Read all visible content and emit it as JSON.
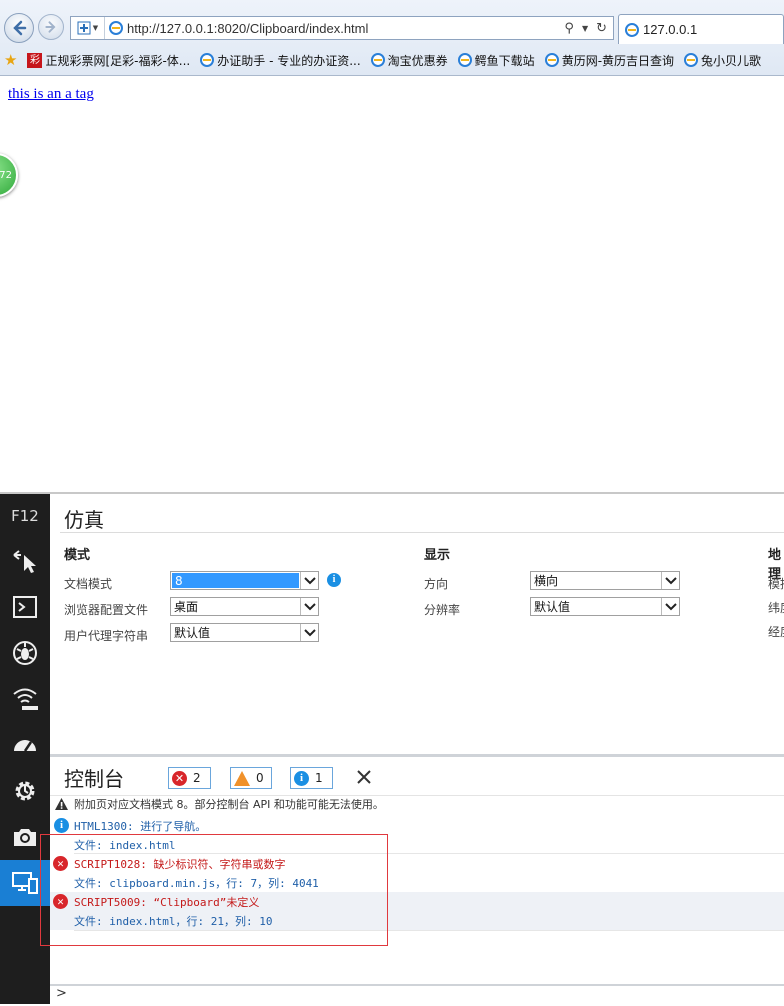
{
  "browser": {
    "url": "http://127.0.0.1:8020/Clipboard/index.html",
    "tab_title": "127.0.0.1",
    "favorites": [
      {
        "label": "正规彩票网[足彩-福彩-体...",
        "icon": "cai-icon",
        "icon_text": "彩"
      },
      {
        "label": "办证助手 - 专业的办证资...",
        "icon": "ie-page-icon"
      },
      {
        "label": "淘宝优惠券",
        "icon": "ie-page-icon"
      },
      {
        "label": "鳄鱼下载站",
        "icon": "ie-page-icon"
      },
      {
        "label": "黄历网-黄历吉日查询",
        "icon": "ie-page-icon"
      },
      {
        "label": "兔小贝儿歌",
        "icon": "ie-page-icon"
      }
    ]
  },
  "page": {
    "link_text": "this is an a tag",
    "badge_text": "72"
  },
  "devtools": {
    "label": "F12",
    "emulation": {
      "title": "仿真",
      "mode_section": "模式",
      "display_section": "显示",
      "geo_section": "地理",
      "doc_mode_label": "文档模式",
      "doc_mode_value": "8",
      "browser_profile_label": "浏览器配置文件",
      "browser_profile_value": "桌面",
      "ua_label": "用户代理字符串",
      "ua_value": "默认值",
      "orientation_label": "方向",
      "orientation_value": "横向",
      "resolution_label": "分辨率",
      "resolution_value": "默认值",
      "geo_row1": "模拟",
      "geo_row2": "纬度",
      "geo_row3": "经度"
    },
    "console": {
      "title": "控制台",
      "error_count": "2",
      "warning_count": "0",
      "info_count": "1",
      "messages": {
        "warn": "附加页对应文档模式 8。部分控制台 API 和功能可能无法使用。",
        "info": "HTML1300: 进行了导航。",
        "info_file": "文件: index.html",
        "err1": "SCRIPT1028: 缺少标识符、字符串或数字",
        "err1_file": "文件: clipboard.min.js，行: 7，列: 4041",
        "err2": "SCRIPT5009: “Clipboard”未定义",
        "err2_file": "文件: index.html，行: 21，列: 10"
      },
      "prompt": ">"
    }
  },
  "colors": {
    "accent": "#1a7fd4",
    "error": "#d8262b",
    "warning": "#f0912a",
    "info": "#1a8fe3",
    "annotation_box": "#e0393e"
  }
}
